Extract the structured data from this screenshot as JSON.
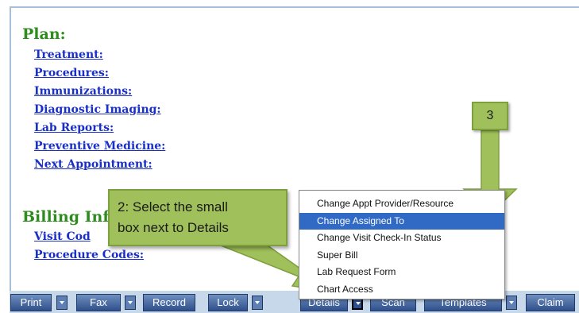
{
  "plan": {
    "title": "Plan:",
    "links": [
      {
        "label": "Treatment:"
      },
      {
        "label": "Procedures:"
      },
      {
        "label": "Immunizations:"
      },
      {
        "label": "Diagnostic Imaging:"
      },
      {
        "label": "Lab Reports:"
      },
      {
        "label": "Preventive Medicine:"
      },
      {
        "label": "Next Appointment:"
      }
    ]
  },
  "billing": {
    "title": "Billing Inf",
    "links": [
      {
        "label": "Visit Cod"
      },
      {
        "label": "Procedure Codes:"
      }
    ]
  },
  "callouts": {
    "step2_line1": "2: Select the small",
    "step2_line2": "box next to Details",
    "step3": "3"
  },
  "menu": {
    "items": [
      {
        "label": "Change Appt Provider/Resource"
      },
      {
        "label": "Change Assigned To",
        "selected": true
      },
      {
        "label": "Change Visit Check-In Status"
      },
      {
        "label": "Super Bill"
      },
      {
        "label": "Lab Request Form"
      },
      {
        "label": "Chart Access"
      }
    ]
  },
  "toolbar": {
    "print": "Print",
    "fax": "Fax",
    "record": "Record",
    "lock": "Lock",
    "details": "Details",
    "scan": "Scan",
    "templates": "Templates",
    "claim": "Claim"
  },
  "colors": {
    "heading_green": "#2e8b1e",
    "link_blue": "#1a2fc7",
    "callout_green": "#9fc05a",
    "menu_highlight": "#316ac5",
    "toolbar_blue": "#3a5a94"
  }
}
